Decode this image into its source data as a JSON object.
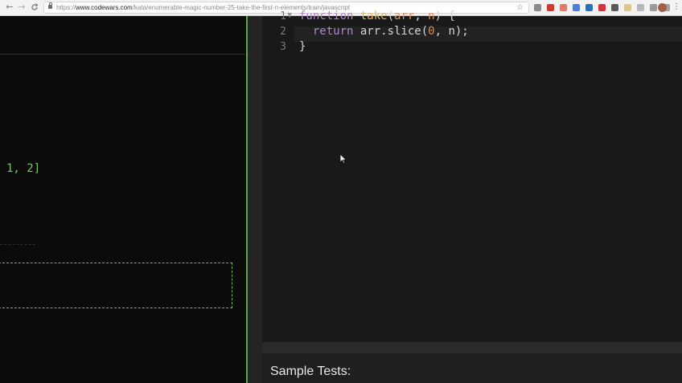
{
  "browser": {
    "url_scheme": "https://",
    "url_host": "www.codewars.com",
    "url_path": "/kata/enumerable-magic-number-25-take-the-first-n-elements/train/javascript",
    "nav": {
      "back": "←",
      "forward": "→",
      "reload": "C"
    },
    "star": "☆",
    "menu": "⋮",
    "extensions": [
      {
        "name": "ext-code-icon",
        "color": "#8a8a8a"
      },
      {
        "name": "ext-red-icon",
        "color": "#d33a2c"
      },
      {
        "name": "ext-pdf-icon",
        "color": "#e07b6a"
      },
      {
        "name": "ext-translate-icon",
        "color": "#4a7fd4"
      },
      {
        "name": "ext-blue-icon",
        "color": "#2f6fb8"
      },
      {
        "name": "ext-opera-icon",
        "color": "#d6303b"
      },
      {
        "name": "ext-pencil-icon",
        "color": "#5b5b5b"
      },
      {
        "name": "ext-note-icon",
        "color": "#d9c88a"
      },
      {
        "name": "ext-square-icon",
        "color": "#b8b8b8"
      },
      {
        "name": "ext-page-icon",
        "color": "#9a9a9a"
      },
      {
        "name": "ext-cloud-icon",
        "color": "#a0a0a0"
      }
    ]
  },
  "left_panel": {
    "snippet": "1, 2]"
  },
  "editor": {
    "line_numbers": [
      "1",
      "2",
      "3"
    ],
    "lines": [
      {
        "parts": [
          {
            "t": "function ",
            "c": "kw"
          },
          {
            "t": "take",
            "c": "fn"
          },
          {
            "t": "(",
            "c": "punc"
          },
          {
            "t": "arr",
            "c": "param"
          },
          {
            "t": ", ",
            "c": "punc"
          },
          {
            "t": "n",
            "c": "param"
          },
          {
            "t": ") {",
            "c": "punc"
          }
        ]
      },
      {
        "parts": [
          {
            "t": "  return ",
            "c": "kw"
          },
          {
            "t": "arr.slice(",
            "c": "punc"
          },
          {
            "t": "0",
            "c": "num"
          },
          {
            "t": ", n);",
            "c": "punc"
          }
        ]
      },
      {
        "parts": [
          {
            "t": "}",
            "c": "punc"
          }
        ]
      }
    ]
  },
  "sample_tests": {
    "title": "Sample Tests:"
  },
  "colors": {
    "accent_green": "#5da83a",
    "code_green": "#7ec65a"
  }
}
